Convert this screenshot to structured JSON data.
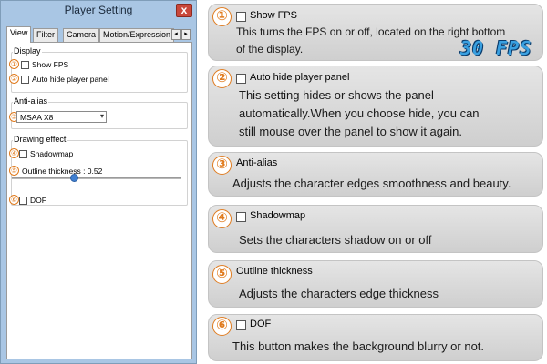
{
  "window": {
    "title": "Player Setting",
    "close_glyph": "x"
  },
  "tabs": [
    {
      "label": "View",
      "active": true
    },
    {
      "label": "Filter"
    },
    {
      "label": "Camera"
    },
    {
      "label": "Motion/Expression"
    }
  ],
  "tab_scroll": {
    "left_glyph": "◂",
    "right_glyph": "▸"
  },
  "panel": {
    "display_group": "Display",
    "show_fps": "Show FPS",
    "auto_hide": "Auto hide player panel",
    "antialias_group": "Anti-alias",
    "antialias_value": "MSAA X8",
    "drawing_group": "Drawing effect",
    "shadowmap": "Shadowmap",
    "outline_label": "Outline thickness : 0.52",
    "outline_value": 0.52,
    "dof": "DOF"
  },
  "markers": [
    "①",
    "②",
    "③",
    "④",
    "⑤",
    "⑥"
  ],
  "cards": [
    {
      "num": "①",
      "title": "Show FPS",
      "desc_lines": [
        "This turns the FPS on or off, located on the right bottom",
        "of the display."
      ],
      "badge": "30 FPS"
    },
    {
      "num": "②",
      "title": "Auto hide player panel",
      "desc_lines": [
        "This setting hides or shows the panel",
        "automatically.When you choose hide, you can",
        "still mouse over the panel to show it again."
      ]
    },
    {
      "num": "③",
      "title": "Anti-alias",
      "desc_lines": [
        "Adjusts the character edges smoothness and beauty."
      ]
    },
    {
      "num": "④",
      "title": "Shadowmap",
      "desc_lines": [
        "Sets the characters shadow on or off"
      ]
    },
    {
      "num": "⑤",
      "title": "Outline thickness",
      "desc_lines": [
        "Adjusts the characters edge thickness"
      ]
    },
    {
      "num": "⑥",
      "title": "DOF",
      "desc_lines": [
        "This button makes the background blurry or not."
      ]
    }
  ],
  "colors": {
    "accent_orange": "#e07b1e",
    "window_frame": "#a9c6e4",
    "slider_thumb": "#3f7fd1",
    "fps_badge": "#3aa0e0"
  }
}
